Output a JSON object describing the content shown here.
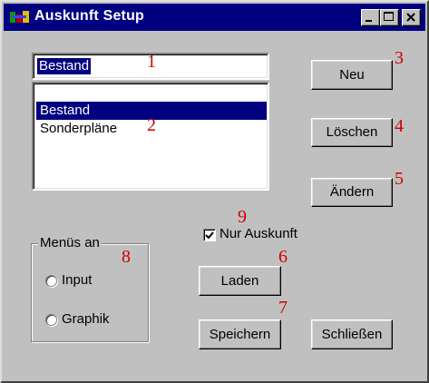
{
  "window": {
    "title": "Auskunft Setup",
    "icon": "app-icon",
    "controls": {
      "minimize": "_",
      "maximize": "□",
      "close": "×"
    }
  },
  "name_input": {
    "value": "Bestand"
  },
  "list": {
    "items": [
      "Bestand",
      "Sonderpläne"
    ],
    "selected": "Bestand"
  },
  "buttons": {
    "neu": "Neu",
    "loeschen": "Löschen",
    "aendern": "Ändern",
    "laden": "Laden",
    "speichern": "Speichern",
    "schliessen": "Schließen"
  },
  "checkbox": {
    "label": "Nur Auskunft",
    "checked": true
  },
  "group": {
    "label": "Menüs an",
    "options": [
      "Input",
      "Graphik"
    ]
  },
  "annotations": [
    "1",
    "2",
    "3",
    "4",
    "5",
    "6",
    "7",
    "8",
    "9"
  ],
  "colors": {
    "titlebar": "#000080",
    "selection": "#000080",
    "annotation": "#cc0000",
    "face": "#c0c0c0"
  }
}
